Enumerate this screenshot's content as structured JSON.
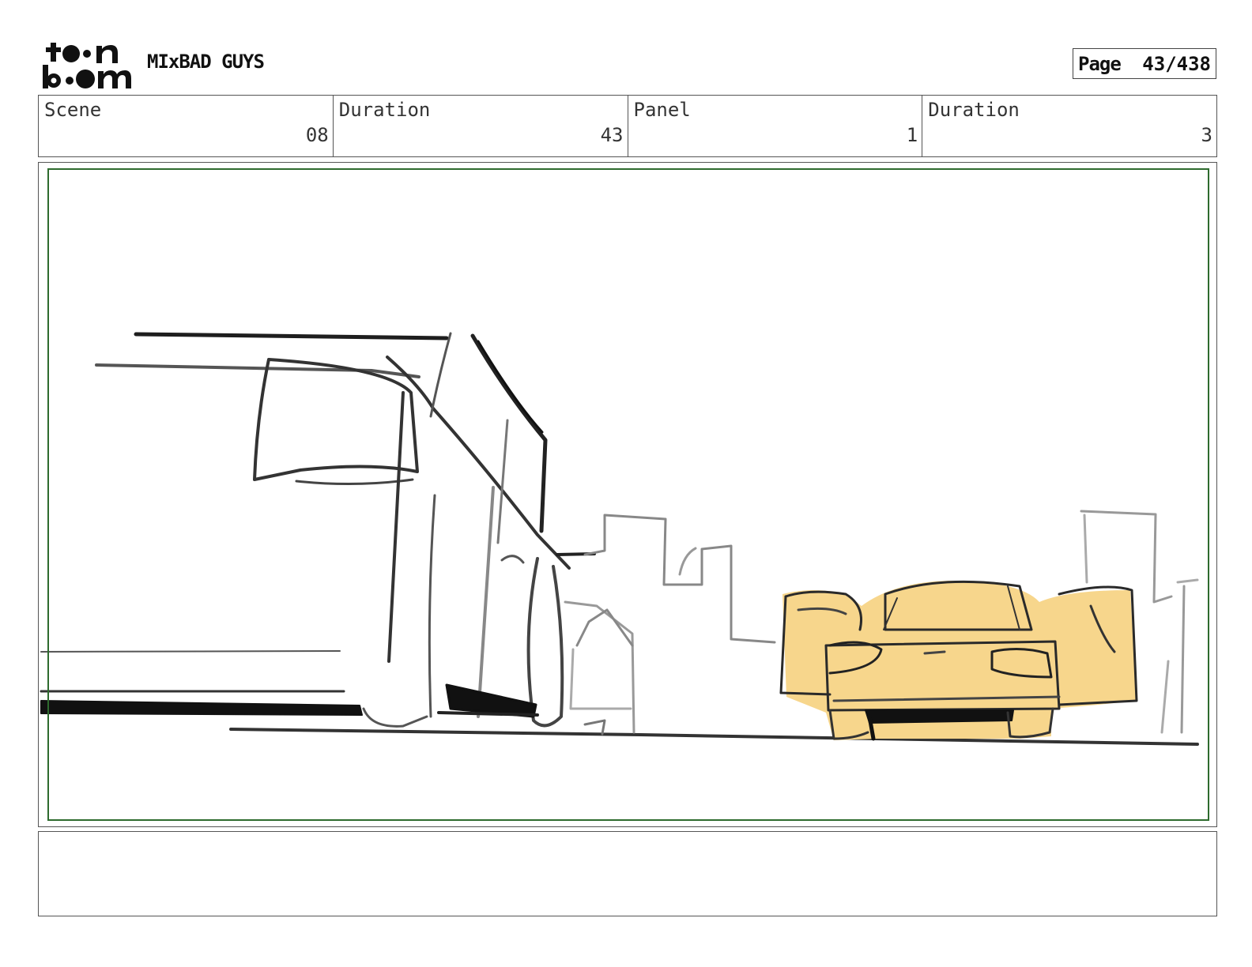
{
  "header": {
    "logo_text": "toon boom",
    "project_title": "MIxBAD GUYS",
    "page_label": "Page",
    "page_value": "43/438"
  },
  "info": {
    "scene_label": "Scene",
    "scene_value": "08",
    "scene_duration_label": "Duration",
    "scene_duration_value": "43",
    "panel_label": "Panel",
    "panel_value": "1",
    "panel_duration_label": "Duration",
    "panel_duration_value": "3"
  },
  "panel": {
    "safe_area_color": "#2e6b2e",
    "car_fill_color": "#f7d68c",
    "sketch_ink_color": "#1e1e1e"
  },
  "notes": {
    "text": ""
  }
}
